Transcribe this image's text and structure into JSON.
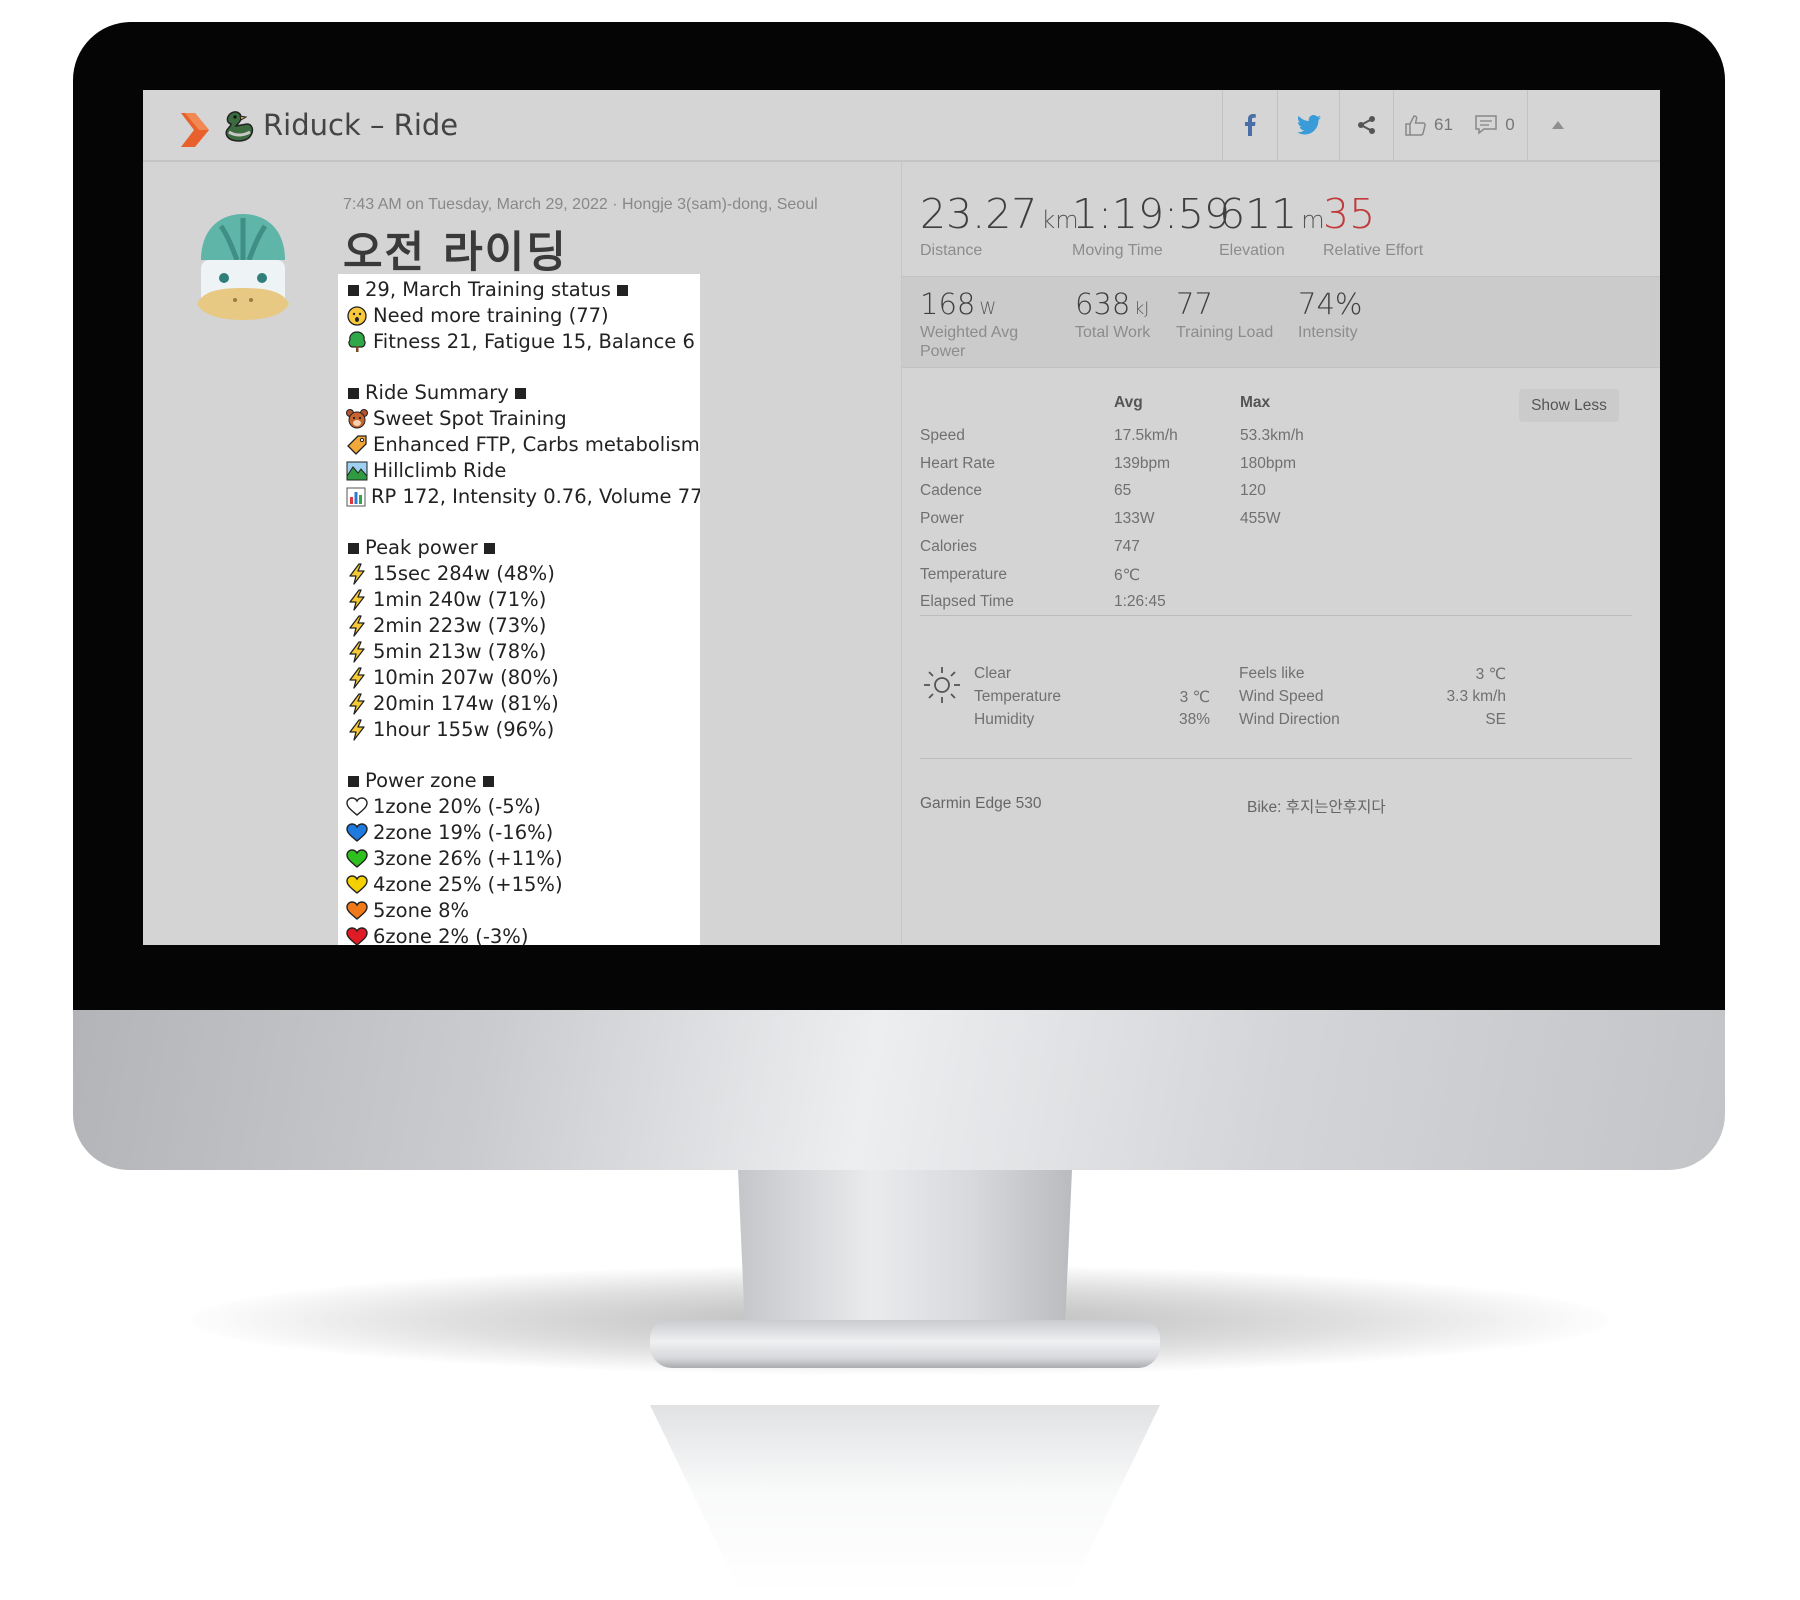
{
  "header": {
    "title": "Riduck – Ride",
    "kudos_count": "61",
    "comment_count": "0"
  },
  "activity": {
    "meta": "7:43 AM on Tuesday, March 29, 2022 · Hongje 3(sam)-dong, Seoul",
    "title": "오전 라이딩"
  },
  "description": {
    "training_header": "29, March Training status",
    "training_need": "Need more training (77)",
    "training_fitness": "Fitness 21, Fatigue 15, Balance 6",
    "summary_header": "Ride Summary",
    "summary_type": "Sweet Spot Training",
    "summary_effect": "Enhanced FTP, Carbs metabolism",
    "summary_ride": "Hillclimb Ride",
    "summary_rp": "RP 172, Intensity 0.76, Volume 77",
    "peak_header": "Peak power",
    "peaks": [
      "15sec 284w (48%)",
      "1min 240w (71%)",
      "2min 223w (73%)",
      "5min 213w (78%)",
      "10min 207w (80%)",
      "20min 174w (81%)",
      "1hour 155w (96%)"
    ],
    "zone_header": "Power zone",
    "zones": [
      {
        "text": "1zone 20% (-5%)",
        "color": "#ffffff"
      },
      {
        "text": "2zone 19% (-16%)",
        "color": "#1f7ae0"
      },
      {
        "text": "3zone 26% (+11%)",
        "color": "#2ec01e"
      },
      {
        "text": "4zone 25% (+15%)",
        "color": "#f5d000"
      },
      {
        "text": "5zone 8%",
        "color": "#f07a1a"
      },
      {
        "text": "6zone 2% (-3%)",
        "color": "#e01b24"
      }
    ]
  },
  "stats": {
    "distance_val": "23.27",
    "distance_unit": "km",
    "distance_label": "Distance",
    "moving_val": "1:19:59",
    "moving_label": "Moving Time",
    "elev_val": "611",
    "elev_unit": "m",
    "elev_label": "Elevation",
    "effort_val": "35",
    "effort_label": "Relative Effort",
    "power_val": "168",
    "power_unit": "W",
    "power_label_1": "Weighted Avg",
    "power_label_2": "Power",
    "work_val": "638",
    "work_unit": "kJ",
    "work_label": "Total Work",
    "load_val": "77",
    "load_label": "Training Load",
    "intensity_val": "74%",
    "intensity_label": "Intensity"
  },
  "details": {
    "show_less": "Show Less",
    "head_avg": "Avg",
    "head_max": "Max",
    "rows": [
      {
        "label": "Speed",
        "avg": "17.5km/h",
        "max": "53.3km/h"
      },
      {
        "label": "Heart Rate",
        "avg": "139bpm",
        "max": "180bpm"
      },
      {
        "label": "Cadence",
        "avg": "65",
        "max": "120"
      },
      {
        "label": "Power",
        "avg": "133W",
        "max": "455W"
      },
      {
        "label": "Calories",
        "avg": "747",
        "max": ""
      },
      {
        "label": "Temperature",
        "avg": "6℃",
        "max": ""
      },
      {
        "label": "Elapsed Time",
        "avg": "1:26:45",
        "max": ""
      }
    ]
  },
  "weather": {
    "condition": "Clear",
    "temp_label": "Temperature",
    "temp_val": "3 ℃",
    "humidity_label": "Humidity",
    "humidity_val": "38%",
    "feels_label": "Feels like",
    "feels_val": "3 ℃",
    "wind_speed_label": "Wind Speed",
    "wind_speed_val": "3.3 km/h",
    "wind_dir_label": "Wind Direction",
    "wind_dir_val": "SE"
  },
  "footer": {
    "device": "Garmin Edge 530",
    "bike": "Bike: 후지는안후지다"
  },
  "colors": {
    "accent_orange": "#e8612c",
    "effort_red": "#c0393b",
    "facebook_blue": "#4a6fa8",
    "twitter_blue": "#3a9bd9"
  }
}
